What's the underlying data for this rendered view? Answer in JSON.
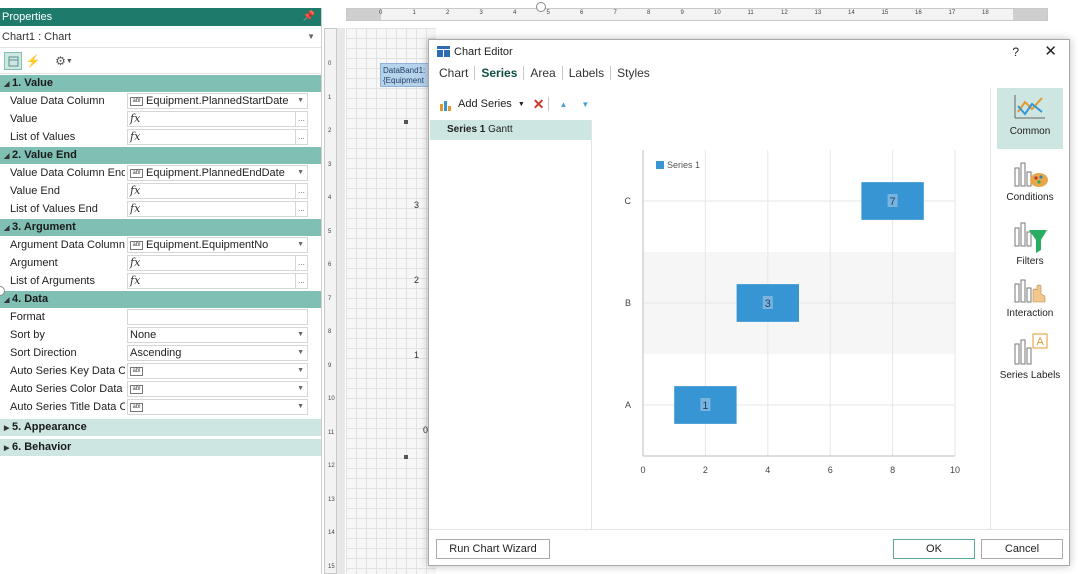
{
  "properties": {
    "title": "Properties",
    "component": "Chart1 : Chart",
    "sections": [
      {
        "label": "1. Value",
        "expanded": true,
        "rows": [
          {
            "label": "Value Data Column",
            "value": "Equipment.PlannedStartDate",
            "icon": "abl"
          },
          {
            "label": "Value",
            "value": "",
            "icon": "fx"
          },
          {
            "label": "List of Values",
            "value": "",
            "icon": "fx"
          }
        ]
      },
      {
        "label": "2. Value End",
        "expanded": true,
        "rows": [
          {
            "label": "Value Data Column End",
            "value": "Equipment.PlannedEndDate",
            "icon": "abl"
          },
          {
            "label": "Value End",
            "value": "",
            "icon": "fx"
          },
          {
            "label": "List of Values End",
            "value": "",
            "icon": "fx"
          }
        ]
      },
      {
        "label": "3. Argument",
        "expanded": true,
        "rows": [
          {
            "label": "Argument Data Column",
            "value": "Equipment.EquipmentNo",
            "icon": "abl"
          },
          {
            "label": "Argument",
            "value": "",
            "icon": "fx"
          },
          {
            "label": "List of Arguments",
            "value": "",
            "icon": "fx"
          }
        ]
      },
      {
        "label": "4. Data",
        "expanded": true,
        "rows": [
          {
            "label": "Format",
            "value": "",
            "icon": ""
          },
          {
            "label": "Sort by",
            "value": "None",
            "icon": ""
          },
          {
            "label": "Sort Direction",
            "value": "Ascending",
            "icon": ""
          },
          {
            "label": "Auto Series Key Data Colu",
            "value": "",
            "icon": "abl"
          },
          {
            "label": "Auto Series Color Data Col",
            "value": "",
            "icon": "abl"
          },
          {
            "label": "Auto Series Title Data Colu",
            "value": "",
            "icon": "abl"
          }
        ]
      },
      {
        "label": "5. Appearance",
        "expanded": false,
        "rows": []
      },
      {
        "label": "6. Behavior",
        "expanded": false,
        "rows": []
      }
    ]
  },
  "designer": {
    "databand_label": "DataBand1:",
    "databand_sub": "{Equipment",
    "top_ruler": [
      "0",
      "1",
      "2",
      "3",
      "4",
      "5",
      "6",
      "7",
      "8",
      "9",
      "10",
      "11",
      "12",
      "13",
      "14",
      "15",
      "16",
      "17",
      "18"
    ],
    "left_ruler": [
      "0",
      "1",
      "2",
      "3",
      "4",
      "5",
      "6",
      "7",
      "8",
      "9",
      "10",
      "11",
      "12",
      "13",
      "14",
      "15"
    ],
    "axis_numbers": [
      "3",
      "2",
      "1",
      "0"
    ]
  },
  "dialog": {
    "title": "Chart Editor",
    "help": "?",
    "close": "✕",
    "tabs": [
      "Chart",
      "Series",
      "Area",
      "Labels",
      "Styles"
    ],
    "selected_tab": "Series",
    "add_series_label": "Add Series",
    "series_item": {
      "name": "Series 1",
      "type": "Gantt"
    },
    "side_items": [
      "Common",
      "Conditions",
      "Filters",
      "Interaction",
      "Series Labels"
    ],
    "footer": {
      "wizard": "Run Chart Wizard",
      "ok": "OK",
      "cancel": "Cancel"
    },
    "colors": {
      "accent": "#1e7a6a",
      "bar": "#3895d3",
      "selection": "#cde6e1"
    }
  },
  "chart_data": {
    "type": "gantt",
    "legend": "Series 1",
    "legend_position": "top-left",
    "categories": [
      "A",
      "B",
      "C"
    ],
    "series": [
      {
        "name": "Series 1",
        "start": [
          1,
          3,
          7
        ],
        "end": [
          3,
          5,
          9
        ],
        "labels": [
          "1",
          "3",
          "7"
        ]
      }
    ],
    "xlim": [
      0,
      10
    ],
    "x_ticks": [
      "0",
      "2",
      "4",
      "6",
      "8",
      "10"
    ],
    "grid": true
  }
}
